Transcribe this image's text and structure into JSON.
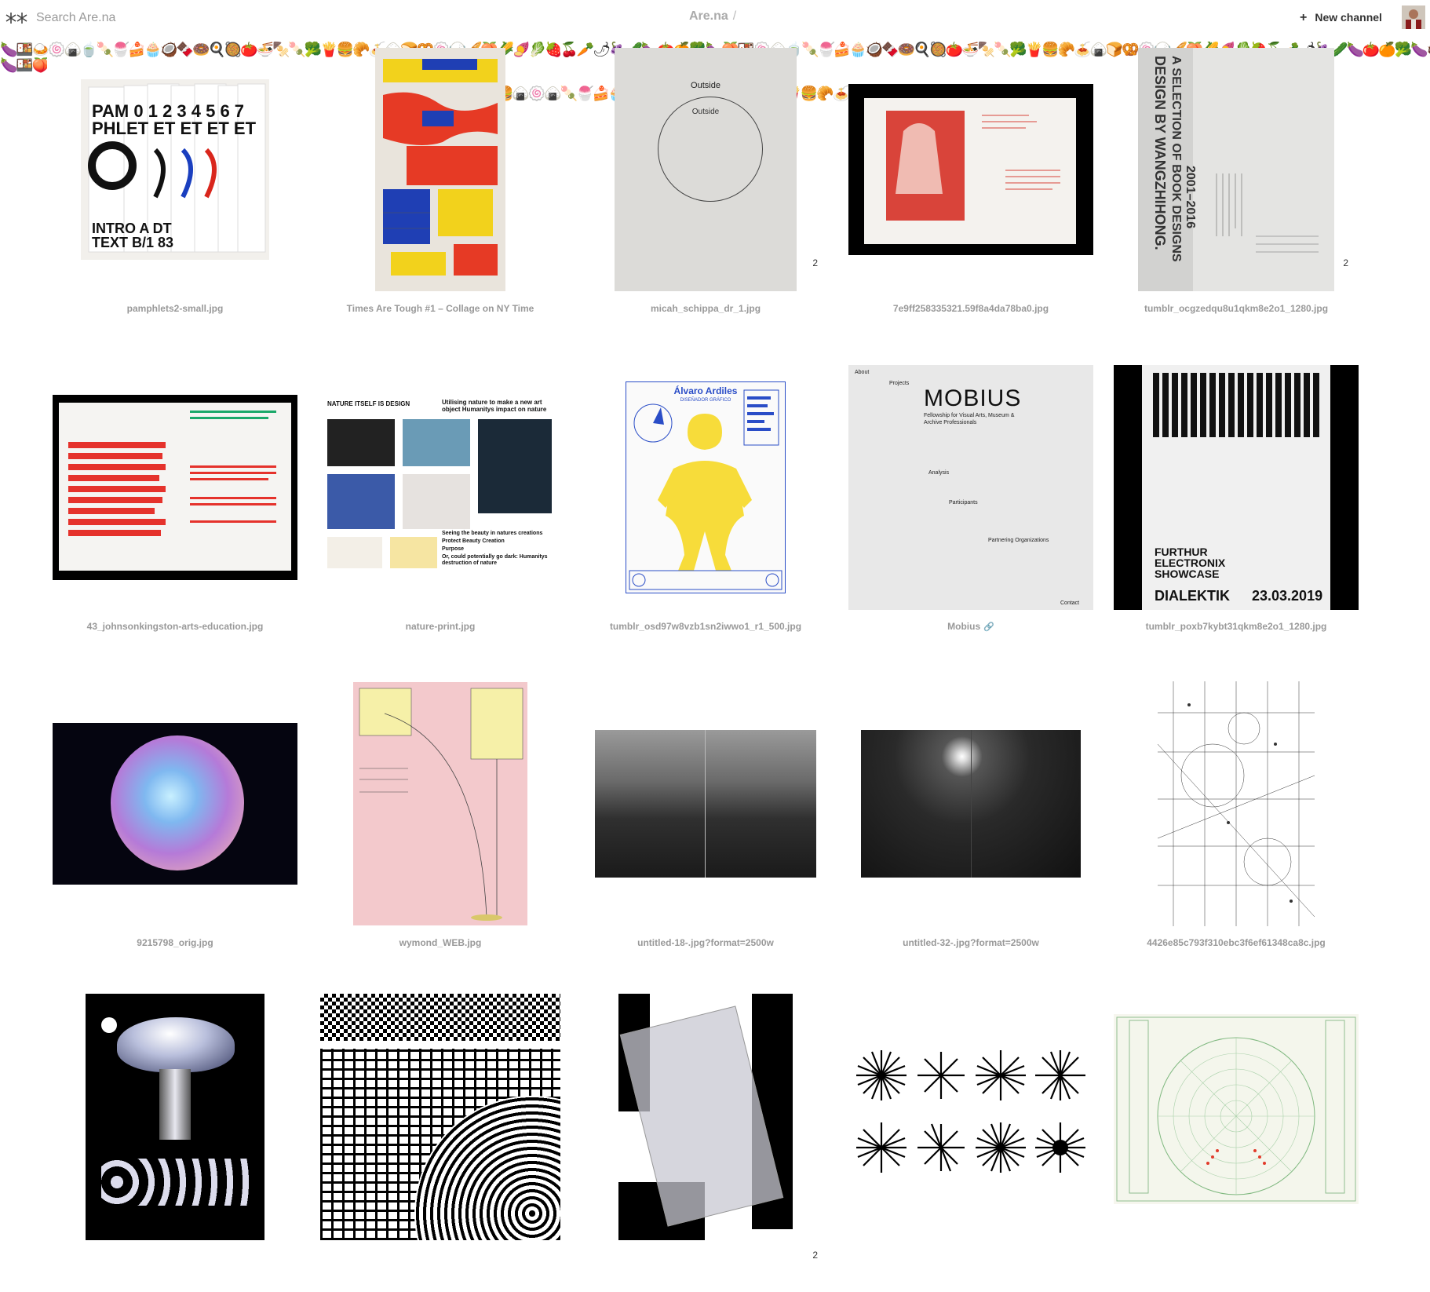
{
  "header": {
    "search_placeholder": "Search Are.na",
    "breadcrumb_title": "Are.na",
    "breadcrumb_sep": "/",
    "new_channel_plus": "+",
    "new_channel_label": "New channel"
  },
  "emoji_strip": {
    "row1": "🍆🍱🍛🍥🍙🍵🍡🍧🍰🧁🥥🍫🍩🍳🥘🍅🍜🍢🍡🥦🍟🍔🥐🍝🍙🍞🥨🍥🍚🥖🍑🌽🍠🥬🍓🍒🥕🌶🍇🥒🍆🍅🍊🥦🍆🍑🍱🍥🍙🍵🍡🍧🍰🧁🥥🍫🍩🍳🥘🍅🍜🍢🍡🥦🍟🍔🥐🍝🍙🍞🥨🍥🍚🥖🍑🌽🍠🥬🍓🍒🥕🌶🍇🥒🍆🍅🍊🥦🍆🥥🍓🍅",
    "row2": "🍆🍱🍑",
    "row3": "🍔🍙🍥🍙🍡🍧🍰🧁🥥🍫🍩🍳🥘🍅🍜🍢🍡🥦🍟🍔🥐🍝🍙🍞🥨🍥🍚🥖🍑🌽🍠🥬🍓🍒"
  },
  "blocks": [
    {
      "caption": "pamphlets2-small.jpg",
      "count": ""
    },
    {
      "caption": "Times Are Tough #1 – Collage on NY Time",
      "count": ""
    },
    {
      "caption": "micah_schippa_dr_1.jpg",
      "count": "2",
      "text_top": "Outside",
      "text_mid": "Outside"
    },
    {
      "caption": "7e9ff258335321.59f8a4da78ba0.jpg",
      "count": ""
    },
    {
      "caption": "tumblr_ocgzedqu8u1qkm8e2o1_1280.jpg",
      "count": "2"
    },
    {
      "caption": "43_johnsonkingston-arts-education.jpg",
      "count": ""
    },
    {
      "caption": "nature-print.jpg",
      "count": "",
      "heading1": "NATURE ITSELF IS DESIGN",
      "heading2": "Utilising nature to make a new art object Humanitys impact on nature",
      "foot1": "Seeing the beauty in natures creations",
      "foot2": "Protect   Beauty   Creation",
      "foot3": "Purpose",
      "foot4": "Or, could potentially go dark: Humanitys destruction of nature"
    },
    {
      "caption": "tumblr_osd97w8vzb1sn2iwwo1_r1_500.jpg",
      "count": "",
      "name": "Álvaro Ardiles",
      "role": "DISEÑADOR GRÁFICO"
    },
    {
      "caption": "Mobius",
      "count": "",
      "is_link": true,
      "title": "MOBIUS",
      "subtitle": "Fellowship for Visual Arts, Museum & Archive Professionals",
      "nav1": "About",
      "nav2": "Projects",
      "nav3": "Analysis",
      "nav4": "Participants",
      "nav5": "Partnering Organizations",
      "nav6": "Contact"
    },
    {
      "caption": "tumblr_poxb7kybt31qkm8e2o1_1280.jpg",
      "count": "",
      "word": "DIALEKTIK",
      "date": "23.03.2019",
      "line1": "FURTHUR",
      "line2": "ELECTRONIX",
      "line3": "SHOWCASE"
    },
    {
      "caption": "9215798_orig.jpg",
      "count": ""
    },
    {
      "caption": "wymond_WEB.jpg",
      "count": ""
    },
    {
      "caption": "untitled-18-.jpg?format=2500w",
      "count": ""
    },
    {
      "caption": "untitled-32-.jpg?format=2500w",
      "count": ""
    },
    {
      "caption": "4426e85c793f310ebc3f6ef61348ca8c.jpg",
      "count": ""
    },
    {
      "caption": "",
      "count": ""
    },
    {
      "caption": "",
      "count": ""
    },
    {
      "caption": "",
      "count": "2"
    },
    {
      "caption": "",
      "count": ""
    },
    {
      "caption": "",
      "count": ""
    }
  ]
}
